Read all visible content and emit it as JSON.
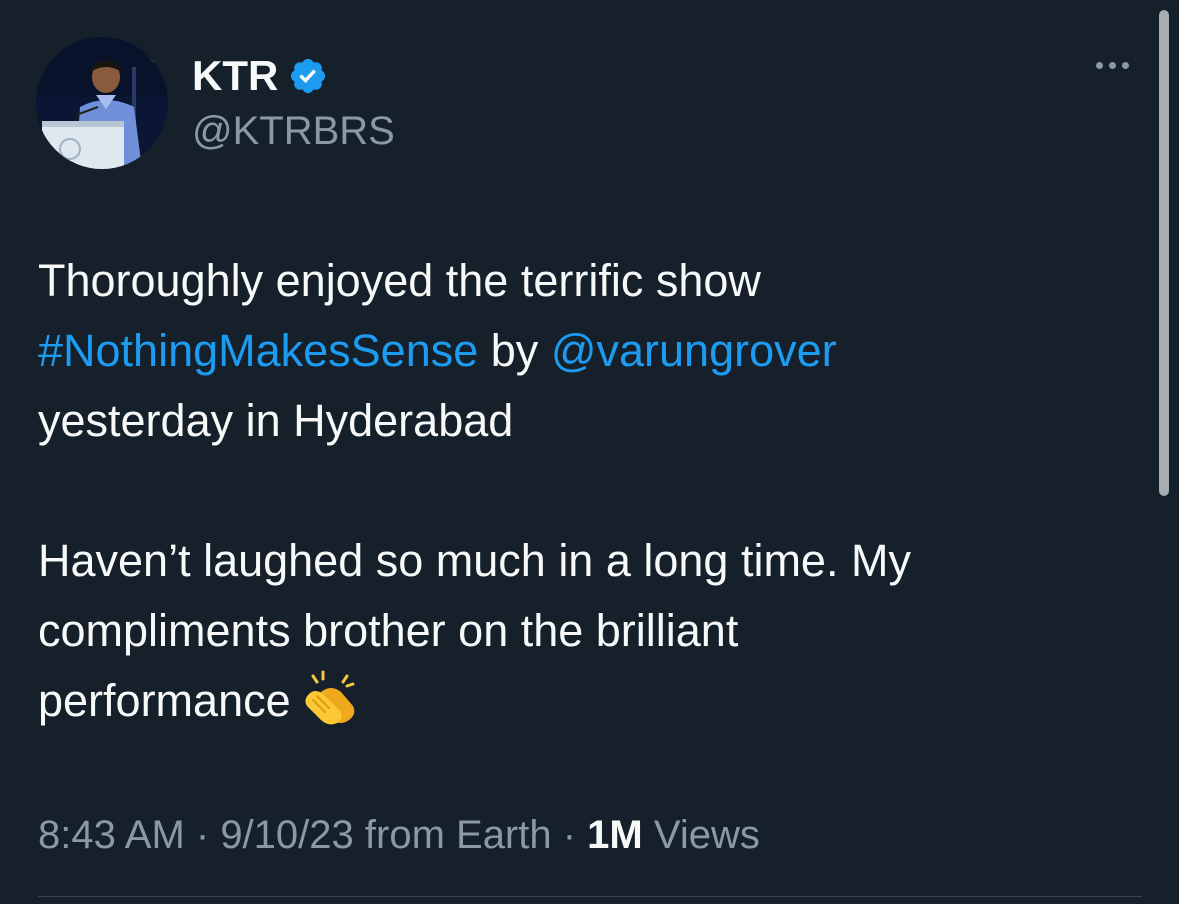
{
  "author": {
    "display_name": "KTR",
    "handle": "@KTRBRS",
    "verified": true,
    "verified_color": "#1d9bf0"
  },
  "tweet": {
    "line1": "Thoroughly enjoyed the terrific show",
    "hashtag": "#NothingMakesSense",
    "by_word": " by ",
    "mention": "@varungrover",
    "line3": "yesterday in Hyderabad",
    "line4": "Haven’t laughed so much in a long time. My",
    "line5": "compliments brother on the brilliant",
    "line6": "performance",
    "emoji": "clapping-hands"
  },
  "meta": {
    "time": "8:43 AM",
    "sep1": " · ",
    "date": "9/10/23",
    "source": " from Earth",
    "sep2": " · ",
    "views_count": "1M",
    "views_label": " Views"
  },
  "colors": {
    "background": "#15202b",
    "text": "#f7f9f9",
    "secondary": "#8b98a5",
    "link": "#1d9bf0"
  },
  "icons": {
    "more": "more-horizontal-icon",
    "verified": "verified-badge-icon"
  }
}
